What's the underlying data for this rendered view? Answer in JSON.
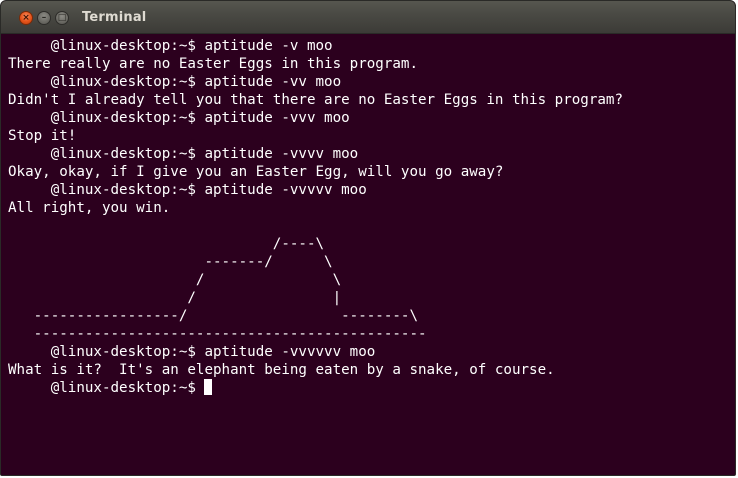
{
  "window": {
    "title": "Terminal",
    "close_glyph": "×",
    "minimize_glyph": "–",
    "maximize_glyph": "□"
  },
  "terminal": {
    "lines": [
      "     @linux-desktop:~$ aptitude -v moo",
      "There really are no Easter Eggs in this program.",
      "     @linux-desktop:~$ aptitude -vv moo",
      "Didn't I already tell you that there are no Easter Eggs in this program?",
      "     @linux-desktop:~$ aptitude -vvv moo",
      "Stop it!",
      "     @linux-desktop:~$ aptitude -vvvv moo",
      "Okay, okay, if I give you an Easter Egg, will you go away?",
      "     @linux-desktop:~$ aptitude -vvvvv moo",
      "All right, you win.",
      "",
      "                               /----\\",
      "                       -------/      \\",
      "                      /               \\",
      "                     /                |",
      "   -----------------/                  --------\\",
      "   ----------------------------------------------",
      "     @linux-desktop:~$ aptitude -vvvvvv moo",
      "What is it?  It's an elephant being eaten by a snake, of course."
    ],
    "prompt": "     @linux-desktop:~$ "
  },
  "colors": {
    "terminal_background": "#2c001e",
    "terminal_foreground": "#ffffff",
    "titlebar": "#3c3b37",
    "close_button": "#e5531a"
  }
}
